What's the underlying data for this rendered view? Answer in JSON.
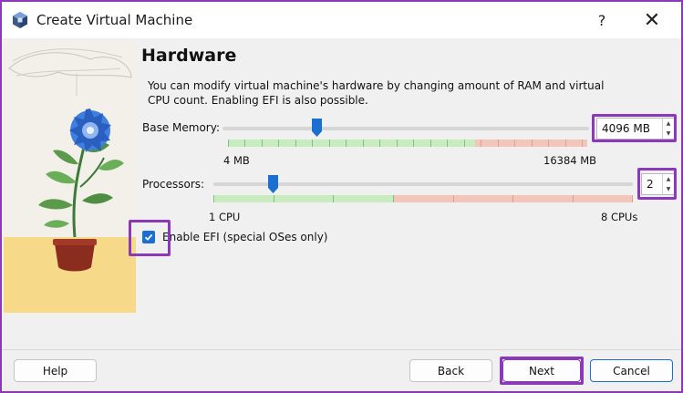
{
  "window": {
    "title": "Create Virtual Machine",
    "help_glyph": "?",
    "close_glyph": "✕"
  },
  "page": {
    "heading": "Hardware",
    "description": "You can modify virtual machine's hardware by changing amount of RAM and virtual CPU count. Enabling EFI is also possible."
  },
  "memory": {
    "label": "Base Memory:",
    "value_text": "4096 MB",
    "value": 4096,
    "min_label": "4 MB",
    "max_label": "16384 MB",
    "min": 4,
    "max": 16384
  },
  "processors": {
    "label": "Processors:",
    "value_text": "2",
    "value": 2,
    "min_label": "1 CPU",
    "max_label": "8 CPUs",
    "min": 1,
    "max": 8
  },
  "efi": {
    "label": "Enable EFI (special OSes only)",
    "checked": true
  },
  "buttons": {
    "help": "Help",
    "back": "Back",
    "next": "Next",
    "cancel": "Cancel"
  },
  "colors": {
    "highlight": "#8a3ab9",
    "accent": "#1a6fd1",
    "range_ok": "#c8ecc0",
    "range_warn": "#f2c6bb"
  }
}
